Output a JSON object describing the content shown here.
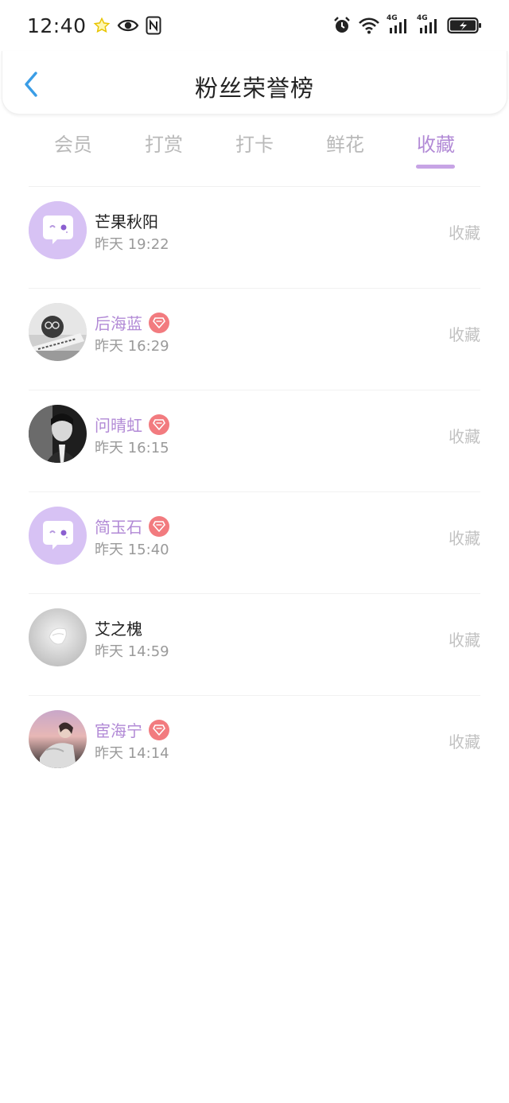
{
  "status_bar": {
    "time": "12:40",
    "left_icons": [
      "star-icon",
      "eye-icon",
      "nfc-icon"
    ],
    "right_icons": [
      "alarm-icon",
      "wifi-icon",
      "signal-4g-icon",
      "signal-4g-icon",
      "battery-charging-icon"
    ],
    "signal_label_1": "4G",
    "signal_label_2": "4G"
  },
  "header": {
    "title": "粉丝荣誉榜",
    "back_icon": "chevron-left-icon",
    "accent_color": "#3a9de6"
  },
  "tabs": [
    {
      "label": "会员",
      "active": false
    },
    {
      "label": "打赏",
      "active": false
    },
    {
      "label": "打卡",
      "active": false
    },
    {
      "label": "鲜花",
      "active": false
    },
    {
      "label": "收藏",
      "active": true
    }
  ],
  "colors": {
    "active_tab": "#b28ad6",
    "vip_name": "#b28ad6",
    "vip_badge": "#f27b7f",
    "muted_text": "#9a9a9a",
    "action_text": "#c2c2c2"
  },
  "rows": [
    {
      "name": "芒果秋阳",
      "vip": false,
      "time": "昨天 19:22",
      "action": "收藏",
      "avatar": "default-chat-avatar"
    },
    {
      "name": "后海蓝",
      "vip": true,
      "time": "昨天 16:29",
      "action": "收藏",
      "avatar": "photo-avatar"
    },
    {
      "name": "问晴虹",
      "vip": true,
      "time": "昨天 16:15",
      "action": "收藏",
      "avatar": "photo-avatar"
    },
    {
      "name": "简玉石",
      "vip": true,
      "time": "昨天 15:40",
      "action": "收藏",
      "avatar": "default-chat-avatar"
    },
    {
      "name": "艾之槐",
      "vip": false,
      "time": "昨天 14:59",
      "action": "收藏",
      "avatar": "photo-avatar"
    },
    {
      "name": "宦海宁",
      "vip": true,
      "time": "昨天 14:14",
      "action": "收藏",
      "avatar": "photo-avatar"
    }
  ]
}
